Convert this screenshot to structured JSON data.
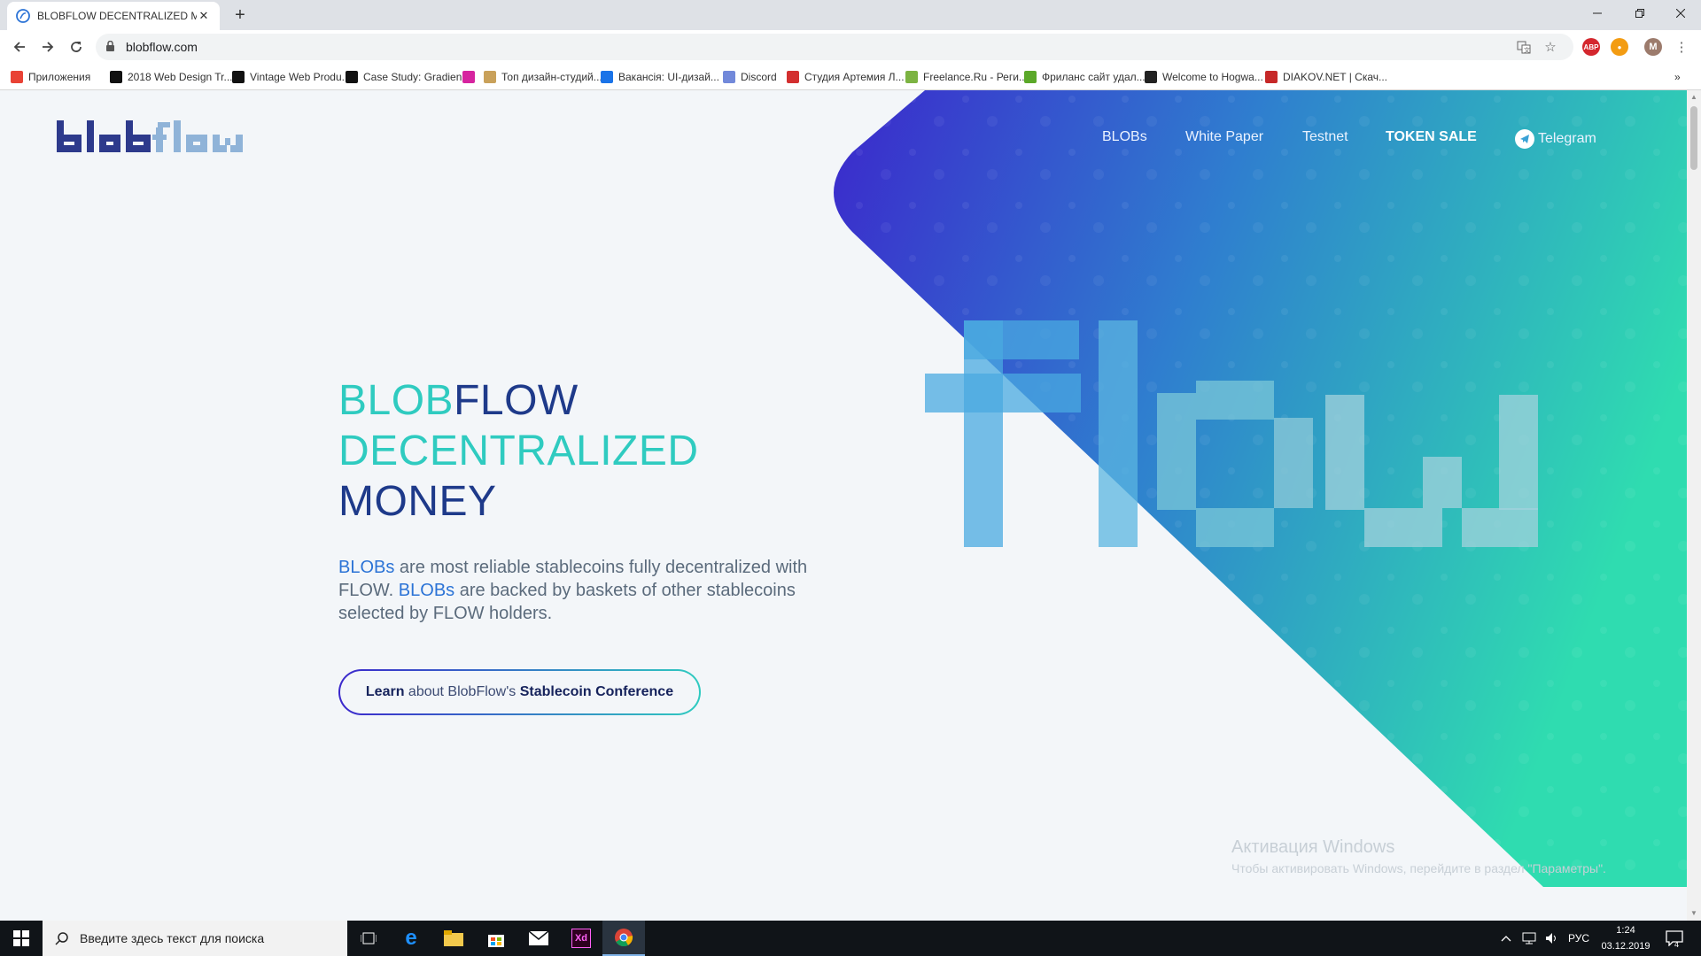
{
  "browser": {
    "tab_title": "BLOBFLOW DECENTRALIZED MO",
    "url": "blobflow.com",
    "bookmarks": [
      {
        "label": "Приложения",
        "color": "#e94235"
      },
      {
        "label": "2018 Web Design Tr...",
        "color": "#111111"
      },
      {
        "label": "Vintage Web Produ...",
        "color": "#111111"
      },
      {
        "label": "Case Study: Gradien...",
        "color": "#111111"
      },
      {
        "label": "",
        "color": "#d6249f"
      },
      {
        "label": "Топ дизайн-студий...",
        "color": "#c9a15a"
      },
      {
        "label": "Вакансія: UI-дизай...",
        "color": "#1a73e8"
      },
      {
        "label": "Discord",
        "color": "#7289da"
      },
      {
        "label": "Студия Артемия Л...",
        "color": "#d32f2f"
      },
      {
        "label": "Freelance.Ru - Реги...",
        "color": "#7cb342"
      },
      {
        "label": "Фриланс сайт удал...",
        "color": "#5ba829"
      },
      {
        "label": "Welcome to Hogwa...",
        "color": "#222222"
      },
      {
        "label": "DIAKOV.NET | Скач...",
        "color": "#c62828"
      }
    ],
    "bookmarks_more": "»",
    "avatar_letter": "M",
    "ext_abp": "ABP"
  },
  "site": {
    "logo_text": "blobflow",
    "nav": {
      "blobs": "BLOBs",
      "white_paper": "White Paper",
      "testnet": "Testnet",
      "token_sale": "TOKEN SALE",
      "telegram": "Telegram"
    },
    "hero_word": "flow",
    "headline": {
      "part1": "BLOB",
      "part2": "FLOW",
      "line2": "DECENTRALIZED",
      "line3": "MONEY"
    },
    "description": {
      "hl1": "BLOBs",
      "t1": " are most reliable stablecoins fully decentralized with FLOW. ",
      "hl2": "BLOBs",
      "t2": " are backed by baskets of other stablecoins selected by FLOW holders."
    },
    "cta": {
      "learn": "Learn",
      "about": " about BlobFlow's ",
      "conference": "Stablecoin Conference"
    },
    "colors": {
      "gradient_start": "#3b28cc",
      "gradient_end": "#2fdcb0",
      "teal": "#2fcbc0",
      "navy": "#1e3a8a",
      "highlight": "#2b73d6"
    }
  },
  "watermark": {
    "title": "Активация Windows",
    "subtitle": "Чтобы активировать Windows, перейдите в раздел \"Параметры\"."
  },
  "taskbar": {
    "search_placeholder": "Введите здесь текст для поиска",
    "lang": "РУС",
    "time": "1:24",
    "date": "03.12.2019",
    "notification_count": "4"
  }
}
